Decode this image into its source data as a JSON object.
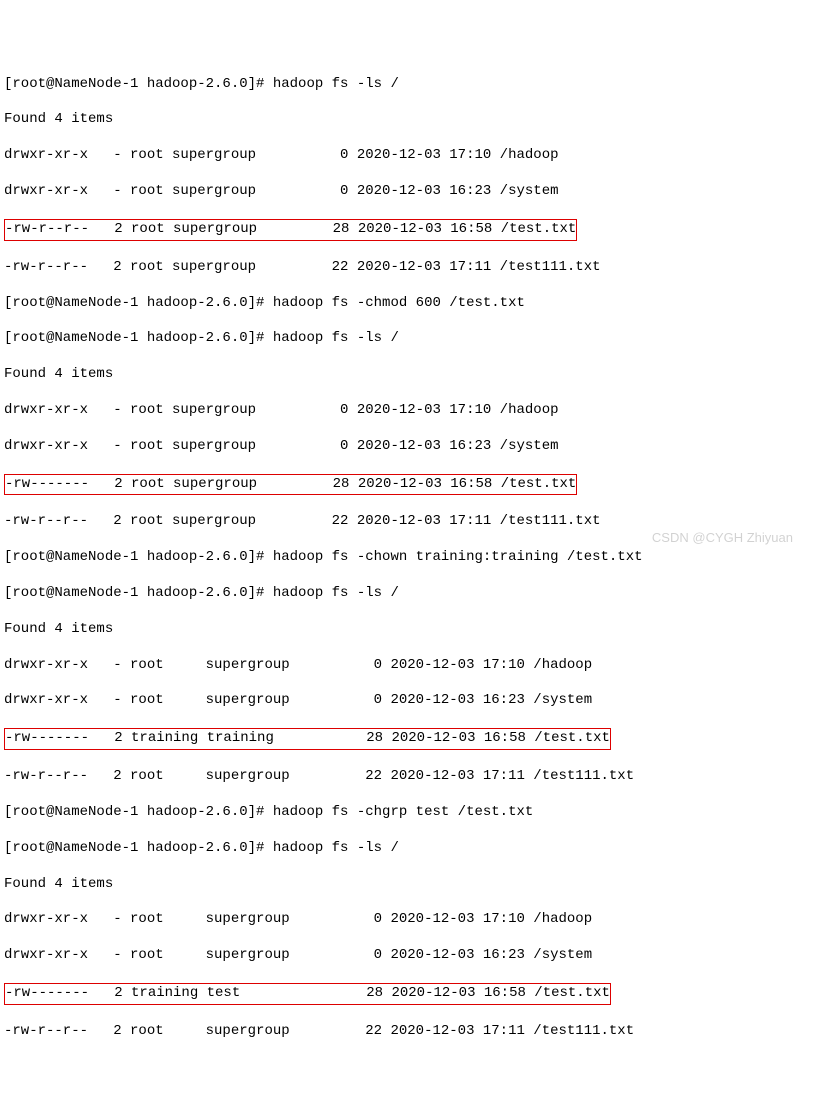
{
  "prompt": "[root@NameNode-1 hadoop-2.6.0]# ",
  "cmd": {
    "ls": "hadoop fs -ls /",
    "chmod": "hadoop fs -chmod 600 /test.txt",
    "chown": "hadoop fs -chown training:training /test.txt",
    "chgrp": "hadoop fs -chgrp test /test.txt"
  },
  "found": "Found 4 items",
  "block1": {
    "hadoop": "drwxr-xr-x   - root supergroup          0 2020-12-03 17:10 /hadoop",
    "system": "drwxr-xr-x   - root supergroup          0 2020-12-03 16:23 /system",
    "test": "-rw-r--r--   2 root supergroup         28 2020-12-03 16:58 /test.txt",
    "test111": "-rw-r--r--   2 root supergroup         22 2020-12-03 17:11 /test111.txt"
  },
  "block2": {
    "hadoop": "drwxr-xr-x   - root supergroup          0 2020-12-03 17:10 /hadoop",
    "system": "drwxr-xr-x   - root supergroup          0 2020-12-03 16:23 /system",
    "test": "-rw-------   2 root supergroup         28 2020-12-03 16:58 /test.txt",
    "test111": "-rw-r--r--   2 root supergroup         22 2020-12-03 17:11 /test111.txt"
  },
  "block3": {
    "hadoop": "drwxr-xr-x   - root     supergroup          0 2020-12-03 17:10 /hadoop",
    "system": "drwxr-xr-x   - root     supergroup          0 2020-12-03 16:23 /system",
    "test": "-rw-------   2 training training           28 2020-12-03 16:58 /test.txt",
    "test111": "-rw-r--r--   2 root     supergroup         22 2020-12-03 17:11 /test111.txt"
  },
  "block4": {
    "hadoop": "drwxr-xr-x   - root     supergroup          0 2020-12-03 17:10 /hadoop",
    "system": "drwxr-xr-x   - root     supergroup          0 2020-12-03 16:23 /system",
    "test": "-rw-------   2 training test               28 2020-12-03 16:58 /test.txt",
    "test111": "-rw-r--r--   2 root     supergroup         22 2020-12-03 17:11 /test111.txt"
  },
  "watermark": "CSDN @CYGH Zhiyuan"
}
